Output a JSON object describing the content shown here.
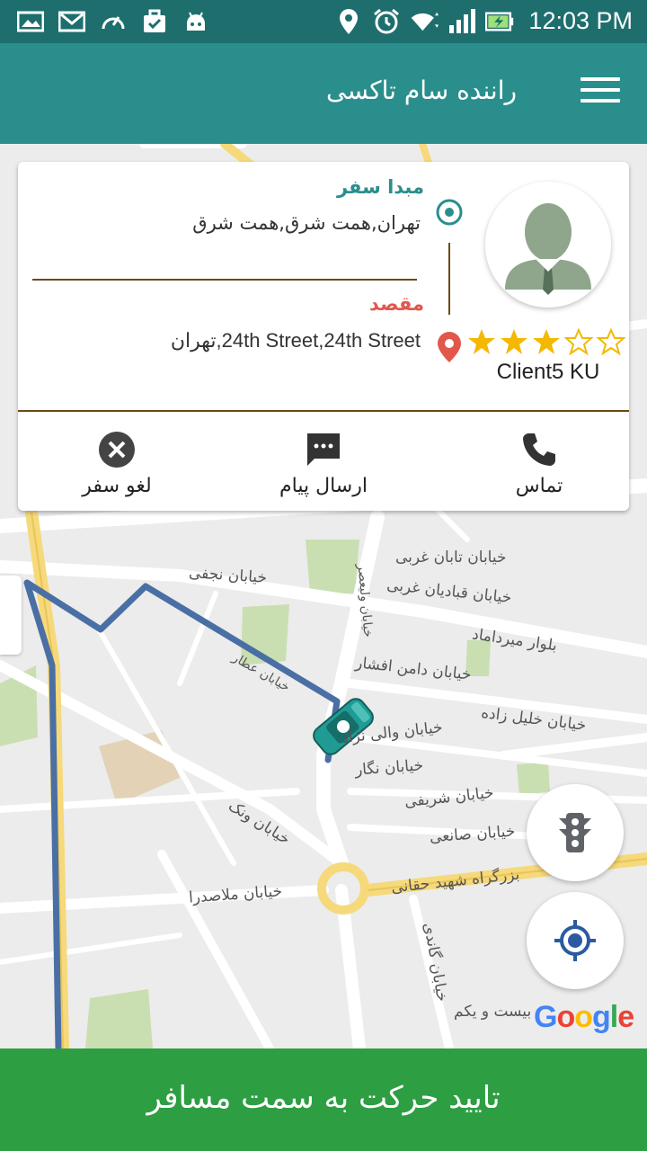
{
  "status_bar": {
    "time": "12:03 PM"
  },
  "app_bar": {
    "title": "راننده سام تاکسی"
  },
  "trip": {
    "origin_label": "مبدا سفر",
    "origin_address": "تهران,همت شرق,همت شرق",
    "destination_label": "مقصد",
    "destination_address": "24th Street,24th Street,تهران",
    "client_name": "Client5 KU",
    "rating": 3,
    "rating_max": 5
  },
  "actions": {
    "call_label": "تماس",
    "message_label": "ارسال پیام",
    "cancel_label": "لغو سفر"
  },
  "map": {
    "street_labels": [
      "خیابان تابان غربی",
      "خیابان نجفی",
      "خیابان قبادیان غربی",
      "بلوار میرداماد",
      "خیابان دامن افشار",
      "خیابان خلیل زاده",
      "خیابان والی نژاد",
      "خیابان نگار",
      "خیابان شریفی",
      "خیابان صانعی",
      "خیابان ونک",
      "بزرگراه شهید حقانی",
      "خیابان ملاصدرا",
      "خیابان گاندی",
      "بیست و یکم",
      "خیابان عطار",
      "خیابان ولیعصر"
    ],
    "attribution": "Google"
  },
  "confirm": {
    "label": "تایید حرکت به سمت مسافر"
  },
  "colors": {
    "primary": "#2a8f8c",
    "status_bar": "#1e6e6e",
    "confirm": "#2e9e43",
    "route": "#4a6fa5",
    "star": "#f5b800",
    "destination": "#e2574c"
  }
}
